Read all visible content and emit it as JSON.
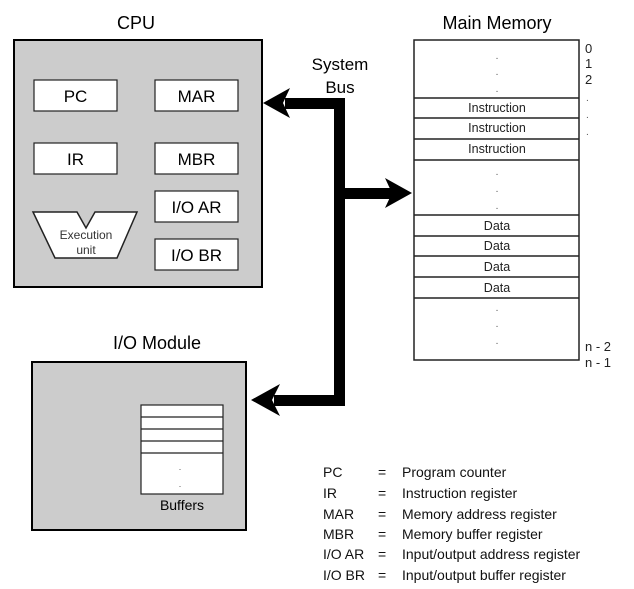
{
  "cpu": {
    "title": "CPU",
    "registers": {
      "pc": "PC",
      "mar": "MAR",
      "ir": "IR",
      "mbr": "MBR",
      "ioar": "I/O AR",
      "iobr": "I/O BR"
    },
    "execution_unit": {
      "line1": "Execution",
      "line2": "unit"
    }
  },
  "bus": {
    "line1": "System",
    "line2": "Bus"
  },
  "memory": {
    "title": "Main Memory",
    "rows": {
      "i1": "Instruction",
      "i2": "Instruction",
      "i3": "Instruction",
      "d1": "Data",
      "d2": "Data",
      "d3": "Data",
      "d4": "Data"
    },
    "addresses": {
      "a0": "0",
      "a1": "1",
      "a2": "2",
      "an2": "n - 2",
      "an1": "n - 1"
    }
  },
  "io_module": {
    "title": "I/O Module",
    "buffers_label": "Buffers"
  },
  "legend": [
    {
      "abbr": "PC",
      "eq": "=",
      "desc": "Program counter"
    },
    {
      "abbr": "IR",
      "eq": "=",
      "desc": "Instruction register"
    },
    {
      "abbr": "MAR",
      "eq": "=",
      "desc": "Memory address register"
    },
    {
      "abbr": "MBR",
      "eq": "=",
      "desc": "Memory buffer register"
    },
    {
      "abbr": "I/O AR",
      "eq": "=",
      "desc": "Input/output address register"
    },
    {
      "abbr": "I/O BR",
      "eq": "=",
      "desc": "Input/output buffer register"
    }
  ],
  "colors": {
    "module_fill": "#cccccc",
    "stroke": "#000000"
  }
}
